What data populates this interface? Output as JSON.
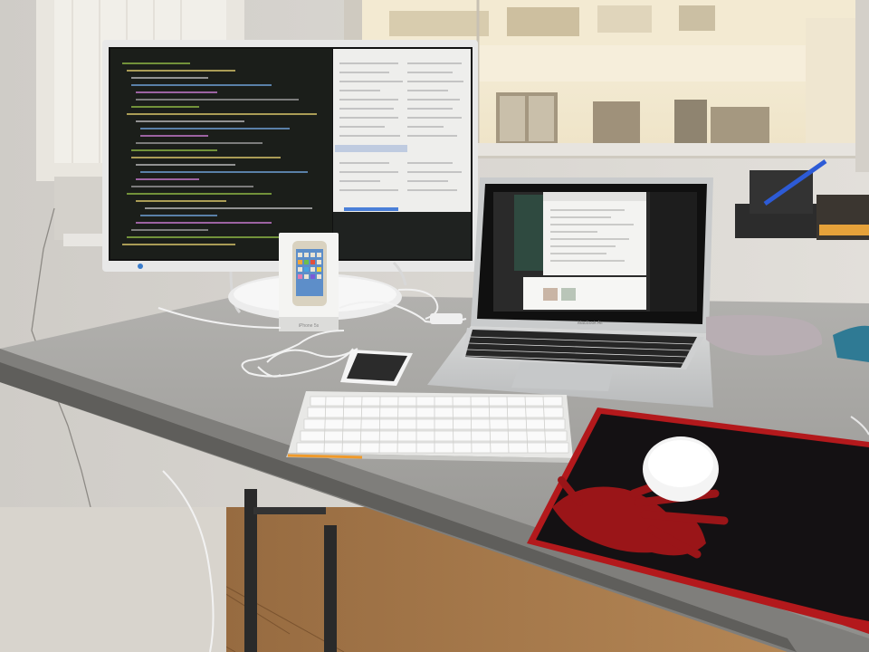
{
  "scene": {
    "description_colors": {
      "wall": "#d9d6d1",
      "desk": "#9d9c99",
      "floor": "#a9794a",
      "mousepad_red": "#b3191c",
      "mousepad_black": "#141113",
      "editor_bg": "#1b1e1a",
      "keyboard": "#e8e8e6"
    },
    "box_label": "iPhone 5s",
    "laptop_label": "MacBook Air"
  }
}
